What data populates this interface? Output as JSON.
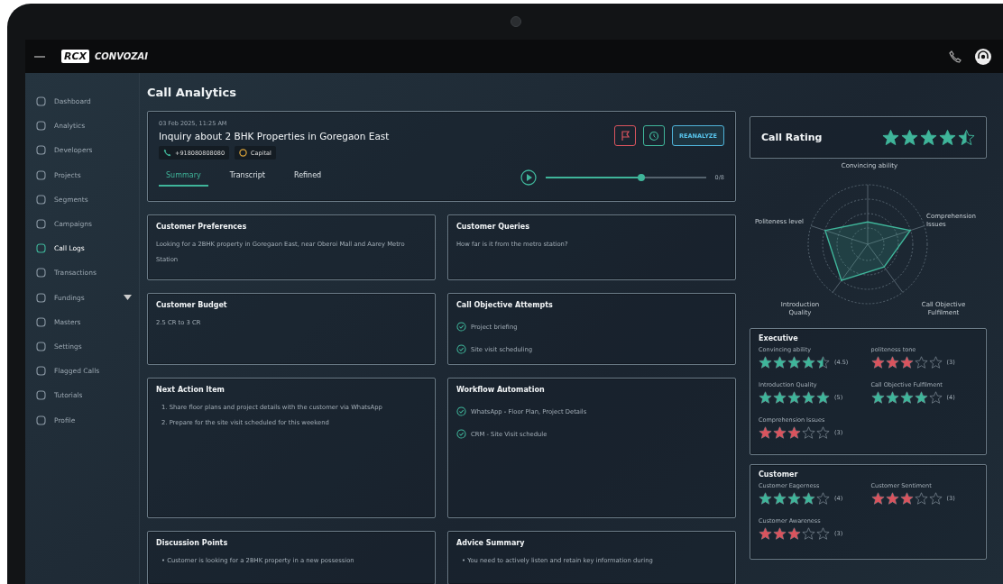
{
  "logo": {
    "badge": "RCX",
    "name": "CONVOZAI"
  },
  "sidebar": {
    "items": [
      {
        "label": "Dashboard",
        "selected": false
      },
      {
        "label": "Analytics",
        "selected": false
      },
      {
        "label": "Developers",
        "selected": false
      },
      {
        "label": "Projects",
        "selected": false
      },
      {
        "label": "Segments",
        "selected": false
      },
      {
        "label": "Campaigns",
        "selected": false
      },
      {
        "label": "Call Logs",
        "selected": true
      },
      {
        "label": "Transactions",
        "selected": false
      },
      {
        "label": "Fundings",
        "selected": false,
        "expanded": false
      },
      {
        "label": "Masters",
        "selected": false
      },
      {
        "label": "Settings",
        "selected": false
      },
      {
        "label": "Flagged Calls",
        "selected": false
      },
      {
        "label": "Tutorials",
        "selected": false
      },
      {
        "label": "Profile",
        "selected": false
      }
    ]
  },
  "page_title": "Call Analytics",
  "call": {
    "datetime": "03 Feb 2025, 11:25 AM",
    "title": "Inquiry about 2 BHK Properties in Goregaon East",
    "phone": "+918080808080",
    "tag": "Capital",
    "reanalyze": "REANALYZE",
    "tabs": [
      {
        "label": "Summary",
        "selected": true
      },
      {
        "label": "Transcript",
        "selected": false
      },
      {
        "label": "Refined",
        "selected": false
      }
    ],
    "player": {
      "level": 0.6,
      "reading": "0/8"
    }
  },
  "cards": [
    {
      "title": "Customer Preferences",
      "kind": "text",
      "items": [
        "Looking for a 2BHK property in Goregaon East, near Oberoi Mall and Aarey Metro Station"
      ]
    },
    {
      "title": "Customer Queries",
      "kind": "text",
      "items": [
        "How far is it from the metro station?"
      ]
    },
    {
      "title": "Customer Budget",
      "kind": "text",
      "items": [
        "2.5 CR to 3 CR"
      ]
    },
    {
      "title": "Call Objective Attempts",
      "kind": "checks",
      "items": [
        "Project briefing",
        "Site visit scheduling"
      ]
    },
    {
      "title": "Next Action Item",
      "kind": "list",
      "items": [
        "1. Share floor plans and project details with the customer via WhatsApp",
        "2. Prepare for the site visit scheduled for this weekend"
      ]
    },
    {
      "title": "Workflow Automation",
      "kind": "checks",
      "items": [
        "WhatsApp - Floor Plan, Project Details",
        "CRM - Site Visit schedule"
      ]
    },
    {
      "title": "Discussion Points",
      "kind": "list",
      "items": [
        "• Customer is looking for a 2BHK property in a new possession"
      ]
    },
    {
      "title": "Advice Summary",
      "kind": "list",
      "items": [
        "• You need to actively listen and retain key information during"
      ]
    }
  ],
  "call_rating": {
    "title": "Call Rating",
    "stars": 4.5
  },
  "radar": {
    "labels": [
      "Convincing ability",
      "Politeness level",
      "Comprehension Issues",
      "Introduction Quality",
      "Call Objective Fulfilment"
    ]
  },
  "groups": [
    {
      "title": "Executive",
      "ratings": [
        {
          "name": "Convincing ability",
          "stars": 4.5,
          "score": "(4.5)",
          "color": "#3fb59a"
        },
        {
          "name": "politeness tone",
          "stars": 3,
          "score": "(3)",
          "color": "#d9545e"
        },
        {
          "name": "Introduction Quality",
          "stars": 5,
          "score": "(5)",
          "color": "#3fb59a"
        },
        {
          "name": "Call Objective Fulfilment",
          "stars": 4,
          "score": "(4)",
          "color": "#3fb59a"
        },
        {
          "name": "Comprehension Issues",
          "stars": 3,
          "score": "(3)",
          "color": "#d9545e"
        }
      ]
    },
    {
      "title": "Customer",
      "ratings": [
        {
          "name": "Customer Eagerness",
          "stars": 4,
          "score": "(4)",
          "color": "#3fb59a"
        },
        {
          "name": "Customer Sentiment",
          "stars": 3,
          "score": "(3)",
          "color": "#d9545e"
        },
        {
          "name": "Customer Awareness",
          "stars": 3,
          "score": "(3)",
          "color": "#d9545e"
        }
      ]
    }
  ]
}
